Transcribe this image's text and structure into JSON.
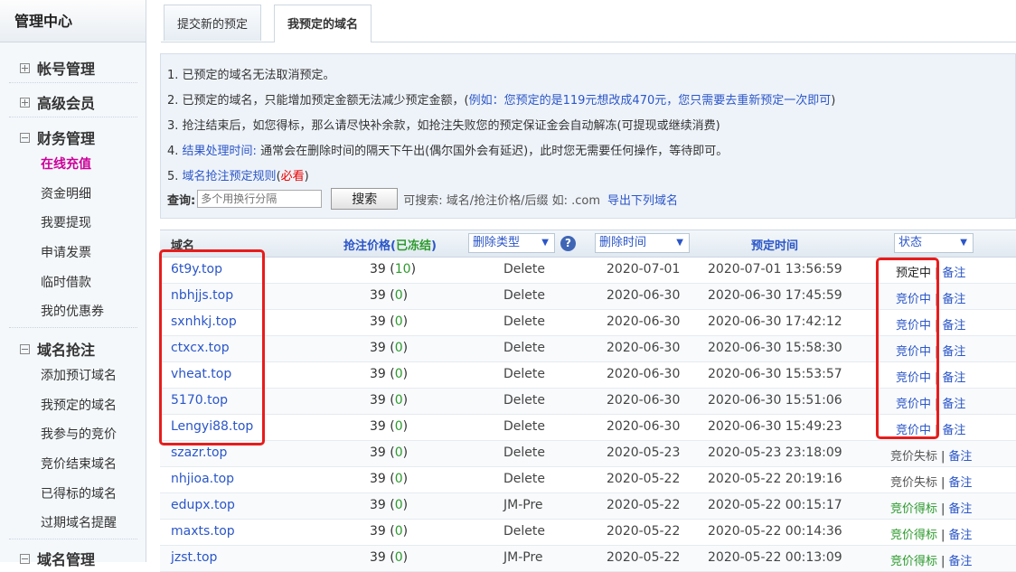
{
  "sidebar": {
    "title": "管理中心",
    "groups": [
      {
        "label": "帐号管理",
        "items": []
      },
      {
        "label": "高级会员",
        "items": []
      },
      {
        "label": "财务管理",
        "items": [
          "在线充值",
          "资金明细",
          "我要提现",
          "申请发票",
          "临时借款",
          "我的优惠券"
        ]
      },
      {
        "label": "域名抢注",
        "items": [
          "添加预订域名",
          "我预定的域名",
          "我参与的竞价",
          "竞价结束域名",
          "已得标的域名",
          "过期域名提醒"
        ]
      },
      {
        "label": "域名管理",
        "items": []
      }
    ]
  },
  "tabs": [
    "提交新的预定",
    "我预定的域名"
  ],
  "notes": {
    "n1": "1. 已预定的域名无法取消预定。",
    "n2_a": "2. 已预定的域名，只能增加预定金额无法减少预定金额，(",
    "n2_b": "例如：您预定的是119元想改成470元，您只需要去重新预定一次即可",
    "n2_c": ")",
    "n3": "3. 抢注结束后，如您得标，那么请尽快补余款，如抢注失败您的预定保证金会自动解冻(可提现或继续消费)",
    "n4_a": "4. ",
    "n4_b": "结果处理时间:",
    "n4_c": " 通常会在删除时间的隔天下午出(偶尔国外会有延迟)，此时您无需要任何操作，等待即可。",
    "n5_a": "5. ",
    "n5_b": "域名抢注预定规则",
    "n5_c": "(",
    "n5_d": "必看",
    "n5_e": ")"
  },
  "search": {
    "label": "查询:",
    "placeholder": "多个用换行分隔",
    "button": "搜索",
    "hint": "可搜索:  域名/抢注价格/后缀 如:  .com",
    "export": "导出下列域名"
  },
  "table": {
    "headers": {
      "domain": "域名",
      "price": "抢注价格",
      "frozen_open": "(",
      "frozen": "已冻结",
      "frozen_close": ")",
      "delete_type": "删除类型",
      "help": "?",
      "delete_time": "删除时间",
      "reserve_time": "预定时间",
      "status": "状态"
    },
    "separator": "|",
    "rows": [
      {
        "domain": "6t9y.top",
        "price": "39",
        "frozen": "10",
        "type": "Delete",
        "delete_time": "2020-07-01",
        "reserve_time": "2020-07-01 13:56:59",
        "status": "预定中",
        "status_color": "#222222",
        "note": "备注"
      },
      {
        "domain": "nbhjjs.top",
        "price": "39",
        "frozen": "0",
        "type": "Delete",
        "delete_time": "2020-06-30",
        "reserve_time": "2020-06-30 17:45:59",
        "status": "竞价中",
        "status_color": "#2b56c8",
        "note": "备注"
      },
      {
        "domain": "sxnhkj.top",
        "price": "39",
        "frozen": "0",
        "type": "Delete",
        "delete_time": "2020-06-30",
        "reserve_time": "2020-06-30 17:42:12",
        "status": "竞价中",
        "status_color": "#2b56c8",
        "note": "备注"
      },
      {
        "domain": "ctxcx.top",
        "price": "39",
        "frozen": "0",
        "type": "Delete",
        "delete_time": "2020-06-30",
        "reserve_time": "2020-06-30 15:58:30",
        "status": "竞价中",
        "status_color": "#2b56c8",
        "note": "备注"
      },
      {
        "domain": "vheat.top",
        "price": "39",
        "frozen": "0",
        "type": "Delete",
        "delete_time": "2020-06-30",
        "reserve_time": "2020-06-30 15:53:57",
        "status": "竞价中",
        "status_color": "#2b56c8",
        "note": "备注"
      },
      {
        "domain": "5170.top",
        "price": "39",
        "frozen": "0",
        "type": "Delete",
        "delete_time": "2020-06-30",
        "reserve_time": "2020-06-30 15:51:06",
        "status": "竞价中",
        "status_color": "#2b56c8",
        "note": "备注"
      },
      {
        "domain": "Lengyi88.top",
        "price": "39",
        "frozen": "0",
        "type": "Delete",
        "delete_time": "2020-06-30",
        "reserve_time": "2020-06-30 15:49:23",
        "status": "竞价中",
        "status_color": "#2b56c8",
        "note": "备注"
      },
      {
        "domain": "szazr.top",
        "price": "39",
        "frozen": "0",
        "type": "Delete",
        "delete_time": "2020-05-23",
        "reserve_time": "2020-05-23 23:18:09",
        "status": "竞价失标",
        "status_color": "#555555",
        "note": "备注"
      },
      {
        "domain": "nhjioa.top",
        "price": "39",
        "frozen": "0",
        "type": "Delete",
        "delete_time": "2020-05-22",
        "reserve_time": "2020-05-22 20:19:16",
        "status": "竞价失标",
        "status_color": "#555555",
        "note": "备注"
      },
      {
        "domain": "edupx.top",
        "price": "39",
        "frozen": "0",
        "type": "JM-Pre",
        "delete_time": "2020-05-22",
        "reserve_time": "2020-05-22 00:15:17",
        "status": "竞价得标",
        "status_color": "#2d9a2d",
        "note": "备注"
      },
      {
        "domain": "maxts.top",
        "price": "39",
        "frozen": "0",
        "type": "Delete",
        "delete_time": "2020-05-22",
        "reserve_time": "2020-05-22 00:14:36",
        "status": "竞价得标",
        "status_color": "#2d9a2d",
        "note": "备注"
      },
      {
        "domain": "jzst.top",
        "price": "39",
        "frozen": "0",
        "type": "JM-Pre",
        "delete_time": "2020-05-22",
        "reserve_time": "2020-05-22 00:13:09",
        "status": "竞价得标",
        "status_color": "#2d9a2d",
        "note": "备注"
      }
    ]
  },
  "colors": {
    "accent": "#2b56c8",
    "active_menu": "#cc0099",
    "highlight": "#e81c1c",
    "frozen": "#2d9a2d"
  }
}
